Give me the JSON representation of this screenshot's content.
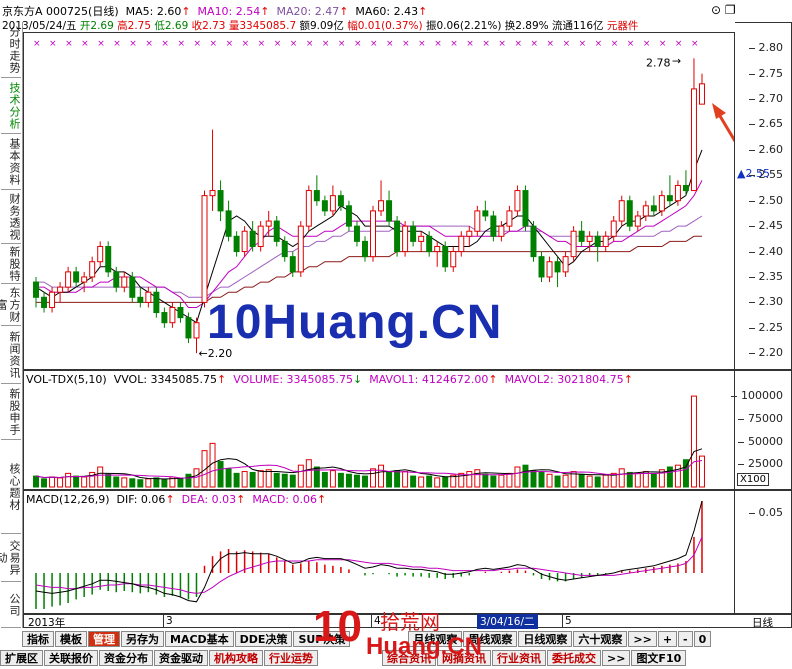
{
  "header": {
    "stock": "京东方A",
    "code": "000725(日线)",
    "ma5": "MA5: 2.60",
    "ma10": "MA10: 2.54",
    "ma20": "MA20: 2.47",
    "ma60": "MA60: 2.43",
    "line2": {
      "date": "2013/05/24/五",
      "open": "开2.69",
      "high": "高2.75",
      "low": "低2.69",
      "close": "收2.73",
      "vol": "量3345085.7",
      "amount": "额9.09亿",
      "change": "幅0.01(0.37%)",
      "amp": "振0.06(2.21%)",
      "turn": "换2.89%",
      "float": "流通116亿",
      "sector": "元器件"
    }
  },
  "price_axis": {
    "ticks": [
      "2.80",
      "2.75",
      "2.70",
      "2.65",
      "2.60",
      "2.55",
      "2.50",
      "2.45",
      "2.40",
      "2.35",
      "2.30",
      "2.25",
      "2.20"
    ],
    "marker": "2.55"
  },
  "annotations": {
    "high": "2.78",
    "low": "2.20"
  },
  "volume_header": {
    "name": "VOL-TDX(5,10)",
    "vvol": "VVOL: 3345085.75",
    "volume": "VOLUME: 3345085.75",
    "mavol1": "MAVOL1: 4124672.00",
    "mavol2": "MAVOL2: 3021804.75"
  },
  "volume_axis": {
    "ticks": [
      "100000",
      "75000",
      "50000",
      "25000"
    ],
    "unit": "X100"
  },
  "macd_header": {
    "name": "MACD(12,26,9)",
    "dif": "DIF: 0.06",
    "dea": "DEA: 0.03",
    "macd": "MACD: 0.06"
  },
  "macd_axis": {
    "ticks": [
      "0.05"
    ]
  },
  "timeline": {
    "year": "2013年",
    "m3": "3",
    "m4": "4",
    "m5": "5",
    "cursor": "3/04/16/二",
    "period": "日线"
  },
  "left_tabs": [
    "分时走势",
    "技术分析",
    "基本资料",
    "财务透视",
    "新股特",
    "东方财富",
    "新闻资讯",
    "新股申手",
    "核心题材",
    "交易异动",
    "公司"
  ],
  "toolbar1": [
    "指标",
    "模板",
    "管理",
    "另存为",
    "MACD基本",
    "DDE决策",
    "SUP决策",
    "",
    "",
    "",
    "月线观察",
    "周线观察",
    "日线观察",
    "六十观察",
    ">>",
    "+",
    "-",
    "0"
  ],
  "toolbar2": [
    "扩展区",
    "关联报价",
    "资金分布",
    "资金驱动",
    "机构攻略",
    "行业运势",
    "",
    "",
    "",
    "综合资讯",
    "网摘资讯",
    "行业资讯",
    "委托成交",
    ">>",
    "图文F10"
  ],
  "watermark": {
    "main": "10Huang.CN",
    "brand_cn": "拾荒网",
    "brand_en": "Huang.CN",
    "num": "10"
  },
  "colors": {
    "up": "#e00000",
    "down": "#008000",
    "ma5": "#000000",
    "ma10": "#c000c0",
    "ma20": "#a060c0",
    "ma60": "#8b1a1a"
  },
  "chart_data": {
    "type": "candlestick",
    "candles": [
      [
        2.34,
        2.35,
        2.29,
        2.31
      ],
      [
        2.31,
        2.32,
        2.28,
        2.29
      ],
      [
        2.29,
        2.33,
        2.28,
        2.32
      ],
      [
        2.32,
        2.34,
        2.3,
        2.33
      ],
      [
        2.33,
        2.37,
        2.32,
        2.36
      ],
      [
        2.36,
        2.37,
        2.33,
        2.34
      ],
      [
        2.34,
        2.36,
        2.32,
        2.35
      ],
      [
        2.35,
        2.39,
        2.34,
        2.38
      ],
      [
        2.38,
        2.42,
        2.37,
        2.41
      ],
      [
        2.41,
        2.42,
        2.35,
        2.36
      ],
      [
        2.36,
        2.37,
        2.32,
        2.33
      ],
      [
        2.33,
        2.36,
        2.32,
        2.35
      ],
      [
        2.35,
        2.36,
        2.3,
        2.31
      ],
      [
        2.31,
        2.33,
        2.29,
        2.3
      ],
      [
        2.3,
        2.33,
        2.29,
        2.32
      ],
      [
        2.32,
        2.33,
        2.27,
        2.28
      ],
      [
        2.28,
        2.29,
        2.25,
        2.26
      ],
      [
        2.26,
        2.3,
        2.25,
        2.29
      ],
      [
        2.29,
        2.3,
        2.26,
        2.27
      ],
      [
        2.27,
        2.28,
        2.22,
        2.23
      ],
      [
        2.23,
        2.27,
        2.2,
        2.26
      ],
      [
        2.3,
        2.52,
        2.29,
        2.51
      ],
      [
        2.51,
        2.64,
        2.48,
        2.52
      ],
      [
        2.52,
        2.54,
        2.46,
        2.48
      ],
      [
        2.48,
        2.5,
        2.42,
        2.43
      ],
      [
        2.43,
        2.44,
        2.39,
        2.4
      ],
      [
        2.4,
        2.45,
        2.39,
        2.44
      ],
      [
        2.44,
        2.46,
        2.4,
        2.41
      ],
      [
        2.41,
        2.46,
        2.4,
        2.45
      ],
      [
        2.45,
        2.48,
        2.43,
        2.46
      ],
      [
        2.46,
        2.47,
        2.41,
        2.42
      ],
      [
        2.42,
        2.43,
        2.38,
        2.39
      ],
      [
        2.39,
        2.4,
        2.35,
        2.36
      ],
      [
        2.36,
        2.46,
        2.35,
        2.45
      ],
      [
        2.45,
        2.53,
        2.44,
        2.52
      ],
      [
        2.52,
        2.55,
        2.49,
        2.5
      ],
      [
        2.5,
        2.51,
        2.47,
        2.48
      ],
      [
        2.48,
        2.53,
        2.47,
        2.51
      ],
      [
        2.51,
        2.52,
        2.48,
        2.49
      ],
      [
        2.49,
        2.5,
        2.44,
        2.45
      ],
      [
        2.45,
        2.46,
        2.41,
        2.42
      ],
      [
        2.42,
        2.43,
        2.38,
        2.39
      ],
      [
        2.39,
        2.49,
        2.38,
        2.48
      ],
      [
        2.48,
        2.54,
        2.47,
        2.5
      ],
      [
        2.5,
        2.52,
        2.45,
        2.46
      ],
      [
        2.46,
        2.47,
        2.39,
        2.4
      ],
      [
        2.4,
        2.46,
        2.39,
        2.45
      ],
      [
        2.45,
        2.46,
        2.41,
        2.42
      ],
      [
        2.42,
        2.44,
        2.4,
        2.43
      ],
      [
        2.43,
        2.44,
        2.39,
        2.4
      ],
      [
        2.4,
        2.42,
        2.37,
        2.41
      ],
      [
        2.41,
        2.42,
        2.36,
        2.37
      ],
      [
        2.37,
        2.41,
        2.36,
        2.4
      ],
      [
        2.4,
        2.44,
        2.39,
        2.43
      ],
      [
        2.43,
        2.45,
        2.41,
        2.44
      ],
      [
        2.44,
        2.49,
        2.43,
        2.48
      ],
      [
        2.48,
        2.5,
        2.46,
        2.47
      ],
      [
        2.47,
        2.48,
        2.42,
        2.43
      ],
      [
        2.43,
        2.46,
        2.42,
        2.45
      ],
      [
        2.45,
        2.49,
        2.44,
        2.48
      ],
      [
        2.48,
        2.53,
        2.47,
        2.52
      ],
      [
        2.52,
        2.53,
        2.44,
        2.45
      ],
      [
        2.45,
        2.46,
        2.38,
        2.39
      ],
      [
        2.39,
        2.4,
        2.34,
        2.35
      ],
      [
        2.35,
        2.39,
        2.34,
        2.38
      ],
      [
        2.38,
        2.39,
        2.33,
        2.36
      ],
      [
        2.36,
        2.4,
        2.35,
        2.39
      ],
      [
        2.39,
        2.45,
        2.38,
        2.44
      ],
      [
        2.44,
        2.46,
        2.41,
        2.42
      ],
      [
        2.42,
        2.44,
        2.4,
        2.43
      ],
      [
        2.43,
        2.44,
        2.38,
        2.41
      ],
      [
        2.41,
        2.44,
        2.4,
        2.43
      ],
      [
        2.43,
        2.47,
        2.42,
        2.46
      ],
      [
        2.46,
        2.51,
        2.45,
        2.5
      ],
      [
        2.5,
        2.51,
        2.44,
        2.45
      ],
      [
        2.45,
        2.48,
        2.44,
        2.47
      ],
      [
        2.47,
        2.5,
        2.46,
        2.49
      ],
      [
        2.49,
        2.51,
        2.47,
        2.48
      ],
      [
        2.48,
        2.52,
        2.47,
        2.51
      ],
      [
        2.51,
        2.55,
        2.49,
        2.5
      ],
      [
        2.5,
        2.54,
        2.49,
        2.53
      ],
      [
        2.53,
        2.56,
        2.51,
        2.52
      ],
      [
        2.52,
        2.78,
        2.52,
        2.72
      ],
      [
        2.69,
        2.75,
        2.69,
        2.73
      ]
    ],
    "ma5": [
      2.33,
      2.32,
      2.31,
      2.32,
      2.32,
      2.33,
      2.34,
      2.35,
      2.37,
      2.37,
      2.36,
      2.36,
      2.35,
      2.33,
      2.32,
      2.31,
      2.3,
      2.29,
      2.28,
      2.27,
      2.26,
      2.31,
      2.36,
      2.41,
      2.46,
      2.47,
      2.46,
      2.44,
      2.43,
      2.43,
      2.43,
      2.42,
      2.41,
      2.42,
      2.44,
      2.45,
      2.46,
      2.47,
      2.49,
      2.48,
      2.47,
      2.45,
      2.45,
      2.45,
      2.45,
      2.44,
      2.44,
      2.44,
      2.44,
      2.43,
      2.42,
      2.41,
      2.41,
      2.41,
      2.41,
      2.42,
      2.44,
      2.45,
      2.45,
      2.46,
      2.47,
      2.47,
      2.45,
      2.43,
      2.41,
      2.39,
      2.37,
      2.38,
      2.4,
      2.41,
      2.42,
      2.42,
      2.43,
      2.45,
      2.46,
      2.46,
      2.47,
      2.47,
      2.48,
      2.49,
      2.5,
      2.51,
      2.56,
      2.6
    ],
    "ma10": [
      2.33,
      2.33,
      2.32,
      2.32,
      2.32,
      2.32,
      2.33,
      2.33,
      2.34,
      2.34,
      2.35,
      2.35,
      2.35,
      2.35,
      2.34,
      2.33,
      2.33,
      2.32,
      2.31,
      2.29,
      2.29,
      2.3,
      2.32,
      2.34,
      2.36,
      2.37,
      2.39,
      2.41,
      2.42,
      2.44,
      2.45,
      2.44,
      2.43,
      2.43,
      2.43,
      2.43,
      2.44,
      2.44,
      2.45,
      2.46,
      2.46,
      2.46,
      2.46,
      2.46,
      2.46,
      2.46,
      2.45,
      2.45,
      2.45,
      2.45,
      2.44,
      2.43,
      2.43,
      2.43,
      2.43,
      2.43,
      2.43,
      2.43,
      2.43,
      2.44,
      2.44,
      2.45,
      2.45,
      2.44,
      2.43,
      2.42,
      2.42,
      2.41,
      2.41,
      2.41,
      2.41,
      2.41,
      2.42,
      2.42,
      2.43,
      2.44,
      2.45,
      2.45,
      2.46,
      2.47,
      2.48,
      2.49,
      2.51,
      2.54
    ],
    "ma20": [
      2.34,
      2.34,
      2.33,
      2.33,
      2.33,
      2.33,
      2.33,
      2.33,
      2.33,
      2.33,
      2.33,
      2.33,
      2.33,
      2.33,
      2.33,
      2.33,
      2.33,
      2.32,
      2.32,
      2.31,
      2.31,
      2.31,
      2.32,
      2.33,
      2.33,
      2.34,
      2.35,
      2.36,
      2.37,
      2.38,
      2.39,
      2.4,
      2.4,
      2.41,
      2.41,
      2.42,
      2.42,
      2.43,
      2.43,
      2.44,
      2.44,
      2.44,
      2.44,
      2.44,
      2.44,
      2.45,
      2.45,
      2.45,
      2.45,
      2.45,
      2.45,
      2.45,
      2.45,
      2.45,
      2.45,
      2.44,
      2.44,
      2.44,
      2.44,
      2.44,
      2.44,
      2.44,
      2.44,
      2.44,
      2.43,
      2.43,
      2.43,
      2.43,
      2.43,
      2.43,
      2.43,
      2.43,
      2.43,
      2.43,
      2.43,
      2.43,
      2.43,
      2.43,
      2.44,
      2.44,
      2.45,
      2.45,
      2.46,
      2.47
    ],
    "ma60": [
      2.3,
      2.3,
      2.3,
      2.3,
      2.3,
      2.3,
      2.3,
      2.3,
      2.3,
      2.3,
      2.3,
      2.3,
      2.3,
      2.3,
      2.3,
      2.3,
      2.3,
      2.3,
      2.3,
      2.3,
      2.3,
      2.3,
      2.31,
      2.31,
      2.32,
      2.32,
      2.33,
      2.33,
      2.34,
      2.34,
      2.35,
      2.35,
      2.36,
      2.36,
      2.37,
      2.37,
      2.38,
      2.38,
      2.38,
      2.39,
      2.39,
      2.39,
      2.39,
      2.39,
      2.39,
      2.4,
      2.4,
      2.4,
      2.4,
      2.4,
      2.4,
      2.4,
      2.4,
      2.4,
      2.4,
      2.4,
      2.4,
      2.4,
      2.4,
      2.4,
      2.4,
      2.4,
      2.4,
      2.4,
      2.4,
      2.4,
      2.4,
      2.4,
      2.4,
      2.4,
      2.4,
      2.4,
      2.4,
      2.4,
      2.4,
      2.41,
      2.41,
      2.41,
      2.41,
      2.42,
      2.42,
      2.42,
      2.43,
      2.43
    ],
    "volume": [
      12000,
      9000,
      11000,
      10000,
      15000,
      12000,
      11000,
      16000,
      22000,
      14000,
      11000,
      10000,
      9000,
      8000,
      9000,
      10000,
      8000,
      11000,
      9000,
      14000,
      20000,
      40000,
      48000,
      28000,
      20000,
      15000,
      17000,
      16000,
      18000,
      19000,
      15000,
      14000,
      13000,
      24000,
      30000,
      22000,
      16000,
      18000,
      15000,
      14000,
      13000,
      12000,
      20000,
      24000,
      16000,
      18000,
      17000,
      12000,
      11000,
      12000,
      10000,
      11000,
      13000,
      15000,
      17000,
      19000,
      14000,
      12000,
      13000,
      15000,
      22000,
      24000,
      18000,
      16000,
      14000,
      12000,
      13000,
      17000,
      14000,
      12000,
      11000,
      13000,
      15000,
      20000,
      16000,
      15000,
      17000,
      15000,
      19000,
      22000,
      24000,
      30000,
      100000,
      34000
    ],
    "macd_hist": [
      -0.03,
      -0.03,
      -0.028,
      -0.027,
      -0.025,
      -0.022,
      -0.02,
      -0.018,
      -0.014,
      -0.015,
      -0.016,
      -0.015,
      -0.016,
      -0.017,
      -0.016,
      -0.018,
      -0.02,
      -0.019,
      -0.02,
      -0.022,
      -0.02,
      0.006,
      0.014,
      0.018,
      0.02,
      0.018,
      0.019,
      0.018,
      0.017,
      0.016,
      0.013,
      0.01,
      0.007,
      0.008,
      0.01,
      0.009,
      0.007,
      0.006,
      0.005,
      0.003,
      0.0,
      -0.002,
      -0.001,
      0.0,
      -0.001,
      -0.003,
      -0.002,
      -0.003,
      -0.003,
      -0.004,
      -0.004,
      -0.005,
      -0.004,
      -0.003,
      -0.002,
      0.0,
      0.001,
      0.0,
      0.001,
      0.002,
      0.003,
      0.002,
      -0.002,
      -0.005,
      -0.006,
      -0.007,
      -0.007,
      -0.005,
      -0.004,
      -0.003,
      -0.002,
      -0.001,
      0.0,
      0.002,
      0.002,
      0.003,
      0.004,
      0.005,
      0.006,
      0.007,
      0.008,
      0.01,
      0.03,
      0.06
    ],
    "dif": [
      -0.015,
      -0.016,
      -0.017,
      -0.016,
      -0.015,
      -0.013,
      -0.011,
      -0.009,
      -0.006,
      -0.006,
      -0.007,
      -0.008,
      -0.009,
      -0.011,
      -0.012,
      -0.014,
      -0.017,
      -0.018,
      -0.02,
      -0.023,
      -0.024,
      -0.012,
      0.004,
      0.012,
      0.016,
      0.016,
      0.017,
      0.016,
      0.016,
      0.016,
      0.014,
      0.011,
      0.008,
      0.009,
      0.012,
      0.013,
      0.012,
      0.012,
      0.012,
      0.01,
      0.007,
      0.004,
      0.005,
      0.007,
      0.006,
      0.004,
      0.004,
      0.003,
      0.003,
      0.002,
      0.001,
      -0.001,
      -0.001,
      0.0,
      0.001,
      0.003,
      0.004,
      0.003,
      0.004,
      0.005,
      0.007,
      0.006,
      0.003,
      -0.001,
      -0.003,
      -0.005,
      -0.006,
      -0.005,
      -0.004,
      -0.003,
      -0.002,
      -0.001,
      0.0,
      0.002,
      0.003,
      0.004,
      0.005,
      0.006,
      0.008,
      0.01,
      0.012,
      0.015,
      0.035,
      0.06
    ],
    "dea": [
      -0.01,
      -0.011,
      -0.012,
      -0.012,
      -0.013,
      -0.013,
      -0.012,
      -0.012,
      -0.011,
      -0.01,
      -0.01,
      -0.009,
      -0.009,
      -0.01,
      -0.01,
      -0.011,
      -0.012,
      -0.013,
      -0.014,
      -0.016,
      -0.017,
      -0.016,
      -0.012,
      -0.007,
      -0.003,
      0.0,
      0.003,
      0.005,
      0.007,
      0.009,
      0.01,
      0.01,
      0.01,
      0.01,
      0.01,
      0.011,
      0.011,
      0.011,
      0.011,
      0.011,
      0.01,
      0.009,
      0.008,
      0.008,
      0.008,
      0.007,
      0.006,
      0.005,
      0.005,
      0.004,
      0.004,
      0.003,
      0.002,
      0.002,
      0.002,
      0.002,
      0.002,
      0.002,
      0.003,
      0.003,
      0.004,
      0.004,
      0.004,
      0.003,
      0.002,
      0.001,
      0.0,
      -0.001,
      -0.002,
      -0.002,
      -0.002,
      -0.002,
      -0.002,
      -0.001,
      0.0,
      0.001,
      0.002,
      0.003,
      0.004,
      0.005,
      0.006,
      0.008,
      0.015,
      0.03
    ]
  }
}
